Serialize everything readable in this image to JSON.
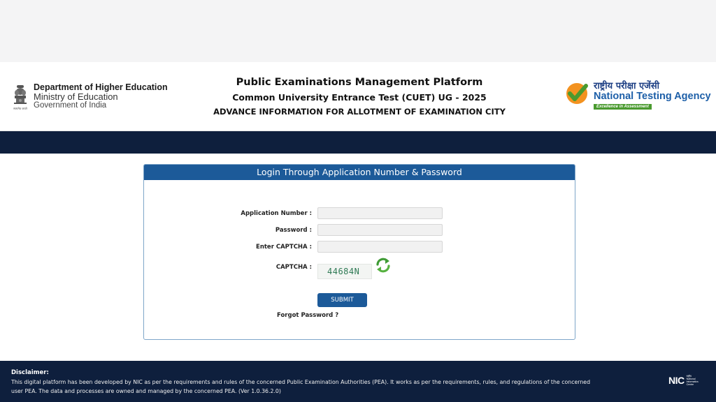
{
  "header": {
    "left_org": {
      "line1": "Department of Higher Education",
      "line2": "Ministry of Education",
      "line3": "Government of India",
      "emblem_caption": "सत्यमेव जयते",
      "icon": "national-emblem-icon"
    },
    "title": "Public Examinations Management Platform",
    "subtitle": "Common University Entrance Test (CUET) UG - 2025",
    "heading": "ADVANCE INFORMATION FOR ALLOTMENT OF EXAMINATION CITY",
    "right_org": {
      "hindi_name": "राष्ट्रीय परीक्षा एजेंसी",
      "english_name": "National Testing Agency",
      "tagline": "Excellence in Assessment",
      "icon": "nta-check-logo-icon"
    }
  },
  "login": {
    "title": "Login Through Application Number & Password",
    "fields": {
      "application_number": {
        "label": "Application Number :",
        "value": "",
        "placeholder": ""
      },
      "password": {
        "label": "Password :",
        "value": "",
        "placeholder": ""
      },
      "captcha_input": {
        "label": "Enter CAPTCHA :",
        "value": "",
        "placeholder": ""
      }
    },
    "captcha": {
      "label": "CAPTCHA :",
      "code": "44684N",
      "refresh_icon": "refresh-icon"
    },
    "submit_label": "SUBMIT",
    "forgot_label": "Forgot Password ?"
  },
  "footer": {
    "disclaimer_title": "Disclaimer:",
    "disclaimer_text": "This digital platform has been developed by NIC as per the requirements and rules of the concerned Public Examination Authorities (PEA). It works as per the requirements, rules, and regulations of the concerned user PEA. The data and processes are owned and managed by the concerned PEA. (Ver 1.0.36.2.0)",
    "nic_logo": "NIC",
    "nic_small": [
      "राष्ट्रीय",
      "National",
      "Informatics",
      "Centre"
    ]
  },
  "colors": {
    "navy": "#0e1f3d",
    "accent_blue": "#1c5a99",
    "nta_green": "#4a9a2f",
    "nta_orange": "#f39220"
  }
}
